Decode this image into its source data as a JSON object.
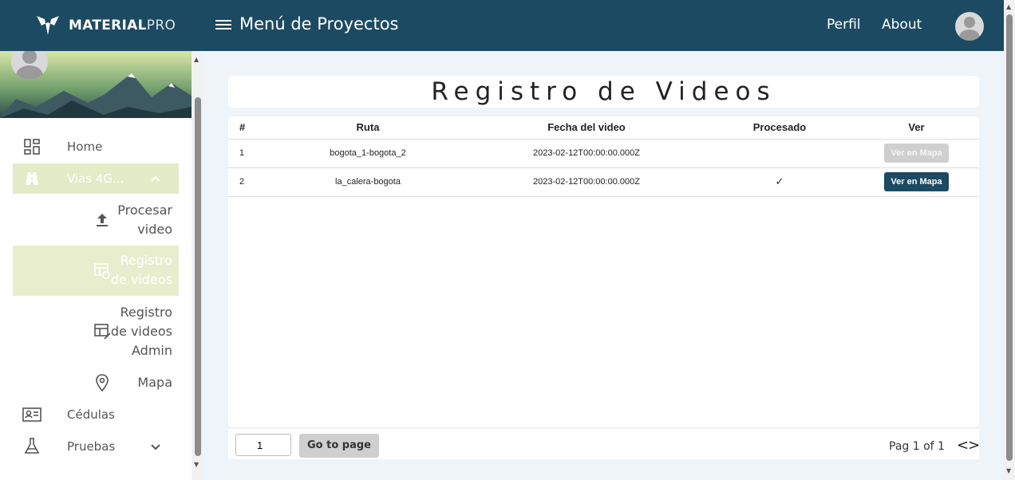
{
  "header": {
    "brand_bold": "MATERIAL",
    "brand_light": "PRO",
    "menu_title": "Menú de Proyectos",
    "links": [
      "Perfil",
      "About"
    ]
  },
  "sidebar": {
    "items": [
      {
        "label": "Home",
        "icon": "dashboard-icon"
      },
      {
        "label": "Vias 4G...",
        "icon": "road-icon"
      },
      {
        "label": "Cédulas",
        "icon": "id-card-icon"
      },
      {
        "label": "Pruebas",
        "icon": "flask-icon"
      }
    ],
    "sub_items": [
      {
        "label_lines": [
          "Procesar",
          "video"
        ],
        "icon": "upload-icon"
      },
      {
        "label_lines": [
          "Registro",
          "de videos"
        ],
        "icon": "video-table-icon"
      },
      {
        "label_lines": [
          "Registro",
          "de videos",
          "Admin"
        ],
        "icon": "table-edit-icon"
      },
      {
        "label_lines": [
          "Mapa"
        ],
        "icon": "location-pin-icon"
      }
    ]
  },
  "page": {
    "title": "Registro de Videos"
  },
  "table": {
    "columns": [
      "#",
      "Ruta",
      "Fecha del video",
      "Procesado",
      "Ver"
    ],
    "rows": [
      {
        "num": "1",
        "ruta": "bogota_1-bogota_2",
        "fecha": "2023-02-12T00:00:00.000Z",
        "procesado": "",
        "ver": "Ver en Mapa",
        "enabled": false
      },
      {
        "num": "2",
        "ruta": "la_calera-bogota",
        "fecha": "2023-02-12T00:00:00.000Z",
        "procesado": "✓",
        "ver": "Ver en Mapa",
        "enabled": true
      }
    ]
  },
  "pager": {
    "page_input": "1",
    "go_label": "Go to page",
    "page_label": "Pag 1 of 1",
    "prev": "<",
    "next": ">"
  },
  "colors": {
    "primary": "#1c4a62",
    "active_bg": "#e3ebc7",
    "background": "#eef4f7"
  }
}
